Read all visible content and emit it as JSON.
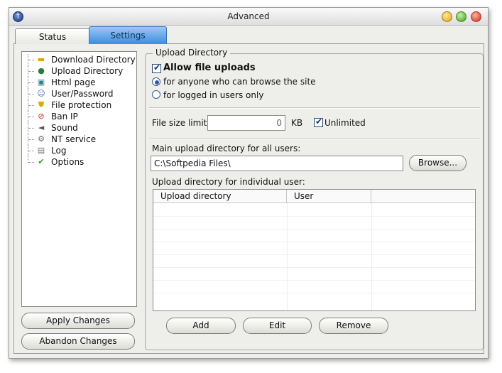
{
  "window": {
    "title": "Advanced"
  },
  "tabs": [
    {
      "label": "Status"
    },
    {
      "label": "Settings"
    }
  ],
  "tree": {
    "items": [
      {
        "label": "Download Directory",
        "icon": "folder-icon"
      },
      {
        "label": "Upload Directory",
        "icon": "globe-upload-icon"
      },
      {
        "label": "Html page",
        "icon": "html-page-icon"
      },
      {
        "label": "User/Password",
        "icon": "user-icon"
      },
      {
        "label": "File protection",
        "icon": "shield-icon"
      },
      {
        "label": "Ban IP",
        "icon": "ban-icon"
      },
      {
        "label": "Sound",
        "icon": "speaker-icon"
      },
      {
        "label": "NT service",
        "icon": "gears-icon"
      },
      {
        "label": "Log",
        "icon": "log-icon"
      },
      {
        "label": "Options",
        "icon": "checkmark-icon"
      }
    ]
  },
  "actions": {
    "apply_label": "Apply Changes",
    "abandon_label": "Abandon Changes"
  },
  "upload": {
    "group_title": "Upload Directory",
    "allow_label": "Allow file uploads",
    "allow_checked": true,
    "radio_anyone_label": "for anyone who can browse the site",
    "radio_logged_label": "for logged in users only",
    "selected_radio": "anyone",
    "size_limit_label": "File size limit:",
    "size_limit_value": "0",
    "size_unit": "KB",
    "unlimited_label": "Unlimited",
    "unlimited_checked": true,
    "main_dir_label": "Main upload directory for all users:",
    "main_dir_value": "C:\\Softpedia Files\\",
    "browse_label": "Browse...",
    "individual_label": "Upload directory for individual user:",
    "table": {
      "columns": [
        "Upload directory",
        "User"
      ],
      "rows": []
    },
    "add_label": "Add",
    "edit_label": "Edit",
    "remove_label": "Remove"
  },
  "colors": {
    "tab_active": "#3d8de0",
    "window_bg": "#eeeeea"
  }
}
